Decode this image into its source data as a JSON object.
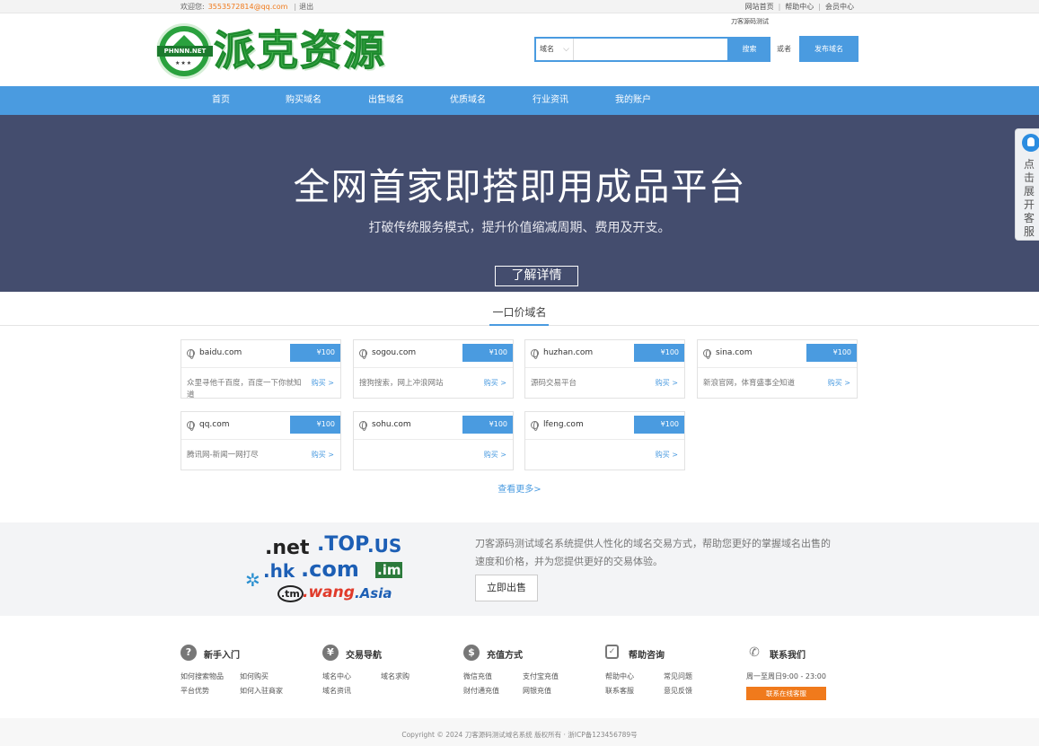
{
  "topbar": {
    "welcome": "欢迎您:",
    "email": "3553572814@qq.com",
    "logout": "退出",
    "links": [
      "网站首页",
      "帮助中心",
      "会员中心"
    ]
  },
  "header": {
    "logo_badge": "PHNNN.NET",
    "logo_stars": "★★★",
    "logo_text": "派克资源",
    "search": {
      "type_selected": "域名",
      "input_placeholder": "",
      "hint": "刀客源码测试",
      "button": "搜索"
    },
    "or": "或者",
    "publish_button": "发布域名"
  },
  "nav": {
    "items": [
      "首页",
      "购买域名",
      "出售域名",
      "优质域名",
      "行业资讯",
      "我的账户"
    ]
  },
  "banner": {
    "headline": "全网首家即搭即用成品平台",
    "subtitle": "打破传统服务模式，提升价值缩减周期、费用及开支。",
    "button": "了解详情"
  },
  "side_widget": {
    "label": "点击展开客服"
  },
  "fixed_price": {
    "title": "一口价域名",
    "buy_label": "购买 >",
    "more_link": "查看更多>",
    "cards": [
      {
        "domain": "baidu.com",
        "price": "¥100",
        "desc": "众里寻他千百度，百度一下你就知道"
      },
      {
        "domain": "sogou.com",
        "price": "¥100",
        "desc": "搜狗搜索，网上冲浪网站"
      },
      {
        "domain": "huzhan.com",
        "price": "¥100",
        "desc": "源码交易平台"
      },
      {
        "domain": "sina.com",
        "price": "¥100",
        "desc": "新浪官网，体育盛事全知道"
      },
      {
        "domain": "qq.com",
        "price": "¥100",
        "desc": "腾讯网-新闻一网打尽"
      },
      {
        "domain": "sohu.com",
        "price": "¥100",
        "desc": ""
      },
      {
        "domain": "lfeng.com",
        "price": "¥100",
        "desc": ""
      }
    ]
  },
  "sell_section": {
    "tlds": [
      ".net",
      ".TOP",
      ".US",
      ".hk",
      ".com",
      ".im",
      ".tm",
      ".wang",
      ".Asia"
    ],
    "text": "刀客源码测试域名系统提供人性化的域名交易方式，帮助您更好的掌握域名出售的速度和价格，并为您提供更好的交易体验。",
    "button": "立即出售"
  },
  "footer": {
    "columns": [
      {
        "icon": "question-icon",
        "title": "新手入门",
        "links": [
          "如何搜索物品",
          "如何购买",
          "平台优势",
          "如何入驻商家"
        ]
      },
      {
        "icon": "user-exchange-icon",
        "title": "交易导航",
        "links": [
          "域名中心",
          "域名求购",
          "域名资讯"
        ]
      },
      {
        "icon": "user-money-icon",
        "title": "充值方式",
        "links": [
          "微信充值",
          "支付宝充值",
          "财付通充值",
          "网银充值"
        ]
      },
      {
        "icon": "shield-icon",
        "title": "帮助咨询",
        "links": [
          "帮助中心",
          "常见问题",
          "联系客服",
          "意见反馈"
        ]
      },
      {
        "icon": "phone-icon",
        "title": "联系我们",
        "links": [
          "周一至周日9:00 - 23:00"
        ],
        "button": "联系在线客服"
      }
    ],
    "copyright": "Copyright © 2024 刀客源码测试域名系统 版权所有 · 浙ICP备123456789号"
  },
  "colors": {
    "accent": "#4a9be0",
    "banner_bg": "#444d6e",
    "orange": "#f07a1c"
  }
}
